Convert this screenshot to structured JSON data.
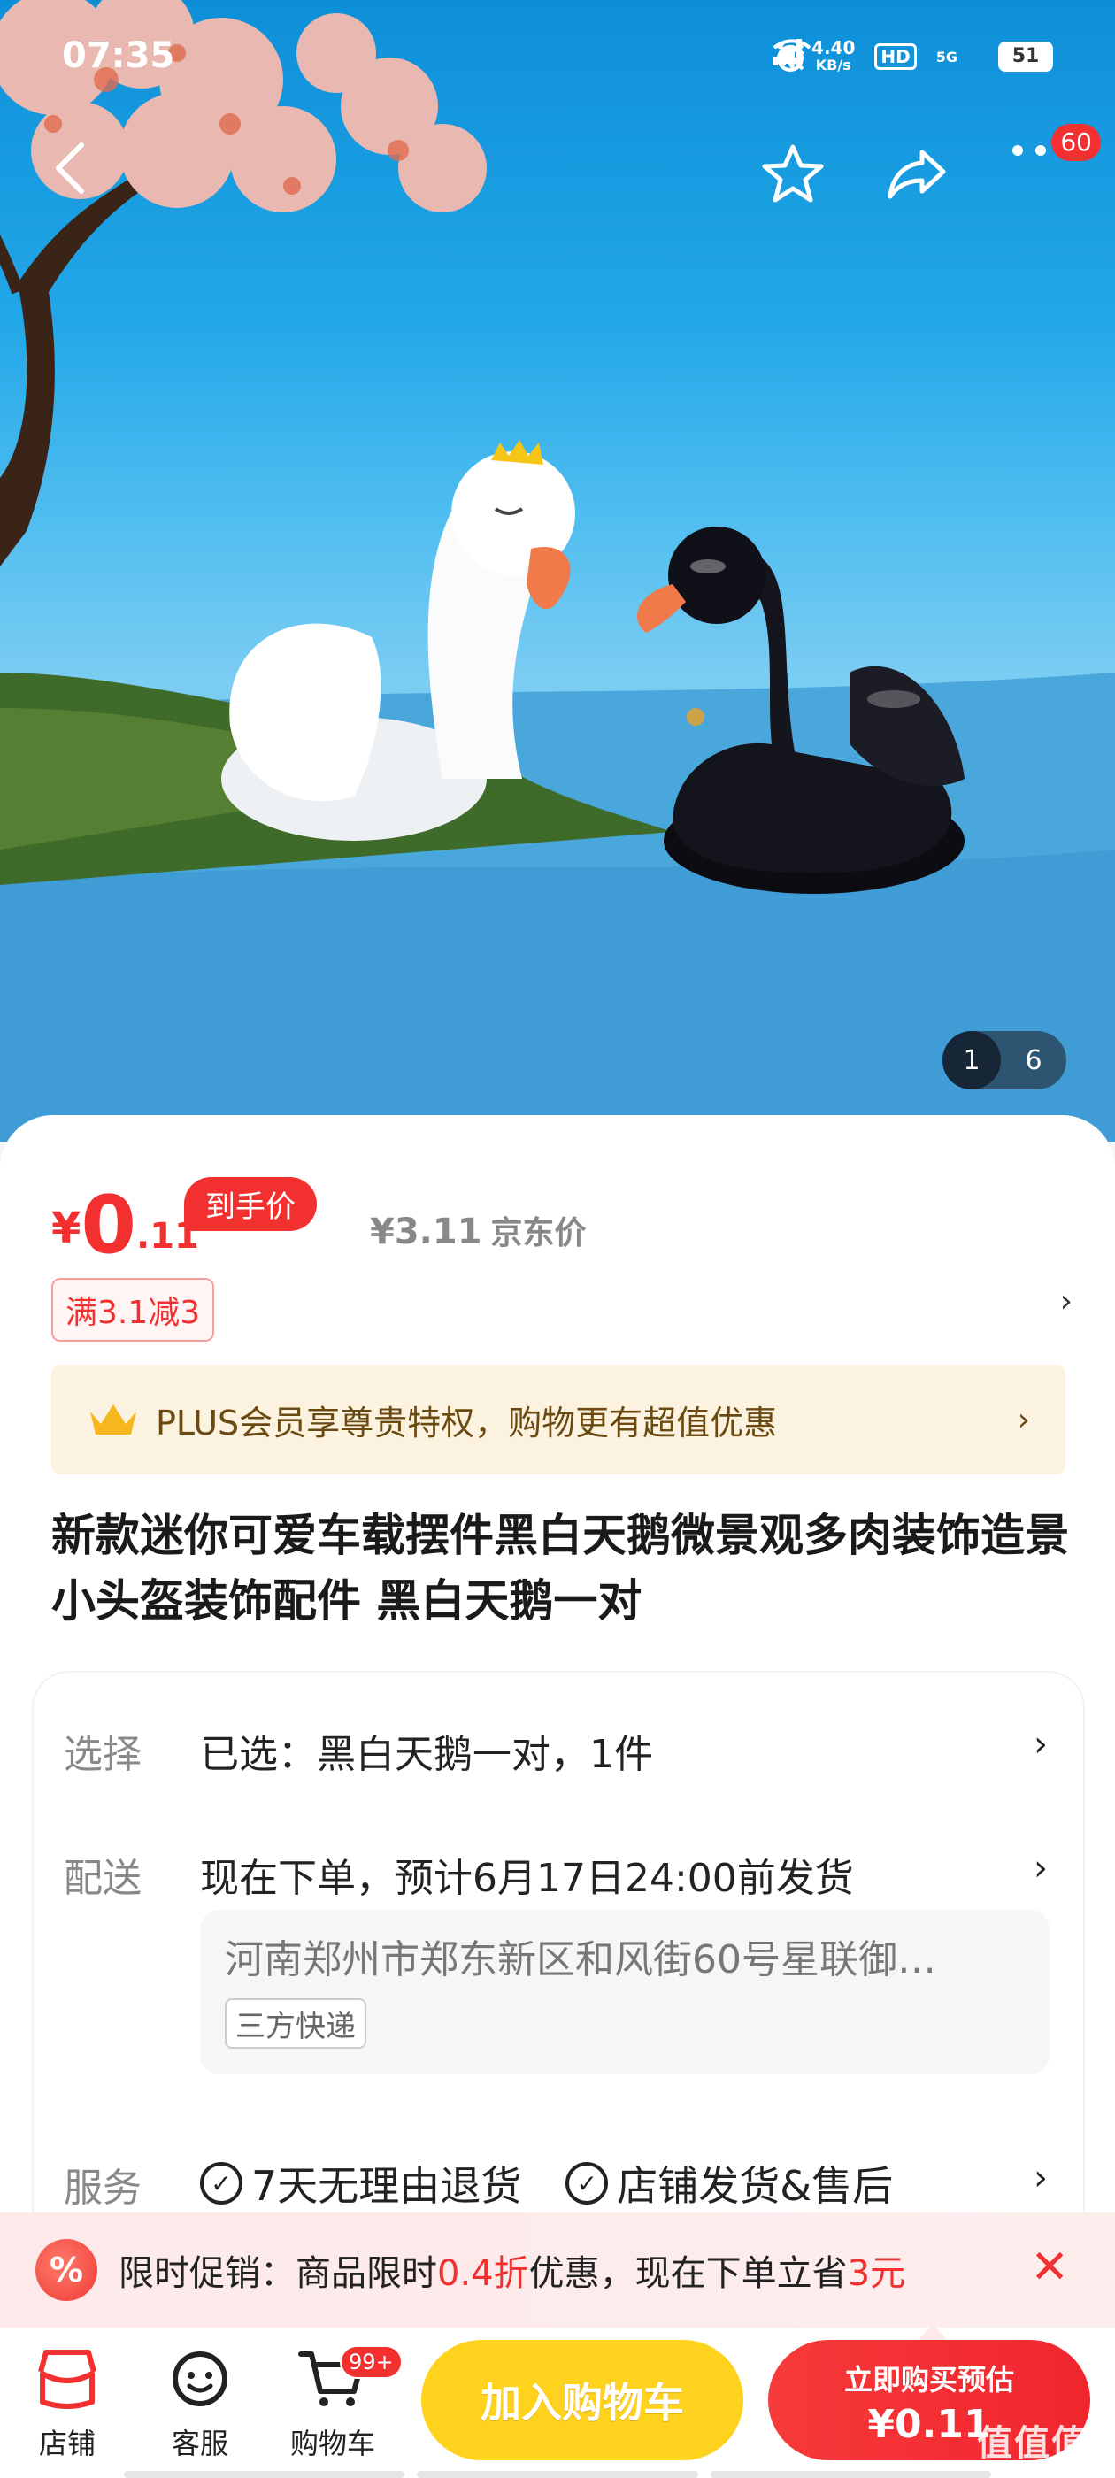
{
  "status_bar": {
    "time": "07:35",
    "speed_top": "4.40",
    "speed_unit": "KB/s",
    "hd": "HD",
    "net": "5G",
    "battery": "51"
  },
  "nav": {
    "badge": "60"
  },
  "gallery": {
    "current": "1",
    "total": "6"
  },
  "price": {
    "yen": "¥",
    "int": "0",
    "dec": ".11",
    "tag": "到手价",
    "jd_price": "¥3.11",
    "jd_label": "京东价"
  },
  "coupon": {
    "text": "满3.1减3",
    "arrow": "›"
  },
  "plus": {
    "text": "PLUS会员享尊贵特权，购物更有超值优惠",
    "arrow": "›"
  },
  "product": {
    "title": "新款迷你可爱车载摆件黑白天鹅微景观多肉装饰造景小头盔装饰配件 黑白天鹅一对"
  },
  "info": {
    "select_label": "选择",
    "select_value": "已选：黑白天鹅一对，1件",
    "delivery_label": "配送",
    "delivery_value": "现在下单，预计6月17日24:00前发货",
    "address": "河南郑州市郑东新区和风街60号星联御…",
    "courier": "三方快递",
    "service_label": "服务",
    "service_1": "7天无理由退货",
    "service_2": "店铺发货&售后",
    "arrow": "›"
  },
  "promo": {
    "icon": "%",
    "prefix": "限时促销：商品限时",
    "discount": "0.4折",
    "middle": "优惠，现在下单立省",
    "save": "3元",
    "close": "✕"
  },
  "bottom": {
    "shop": "店铺",
    "service": "客服",
    "cart": "购物车",
    "cart_badge": "99+",
    "add_cart": "加入购物车",
    "buy_line1": "立即购买预估",
    "buy_line2": "¥0.11",
    "watermark": "值值值"
  },
  "colors": {
    "accent": "#f23030",
    "cart_button": "#ffd21e",
    "plus_bg": "#fcf2e0"
  }
}
